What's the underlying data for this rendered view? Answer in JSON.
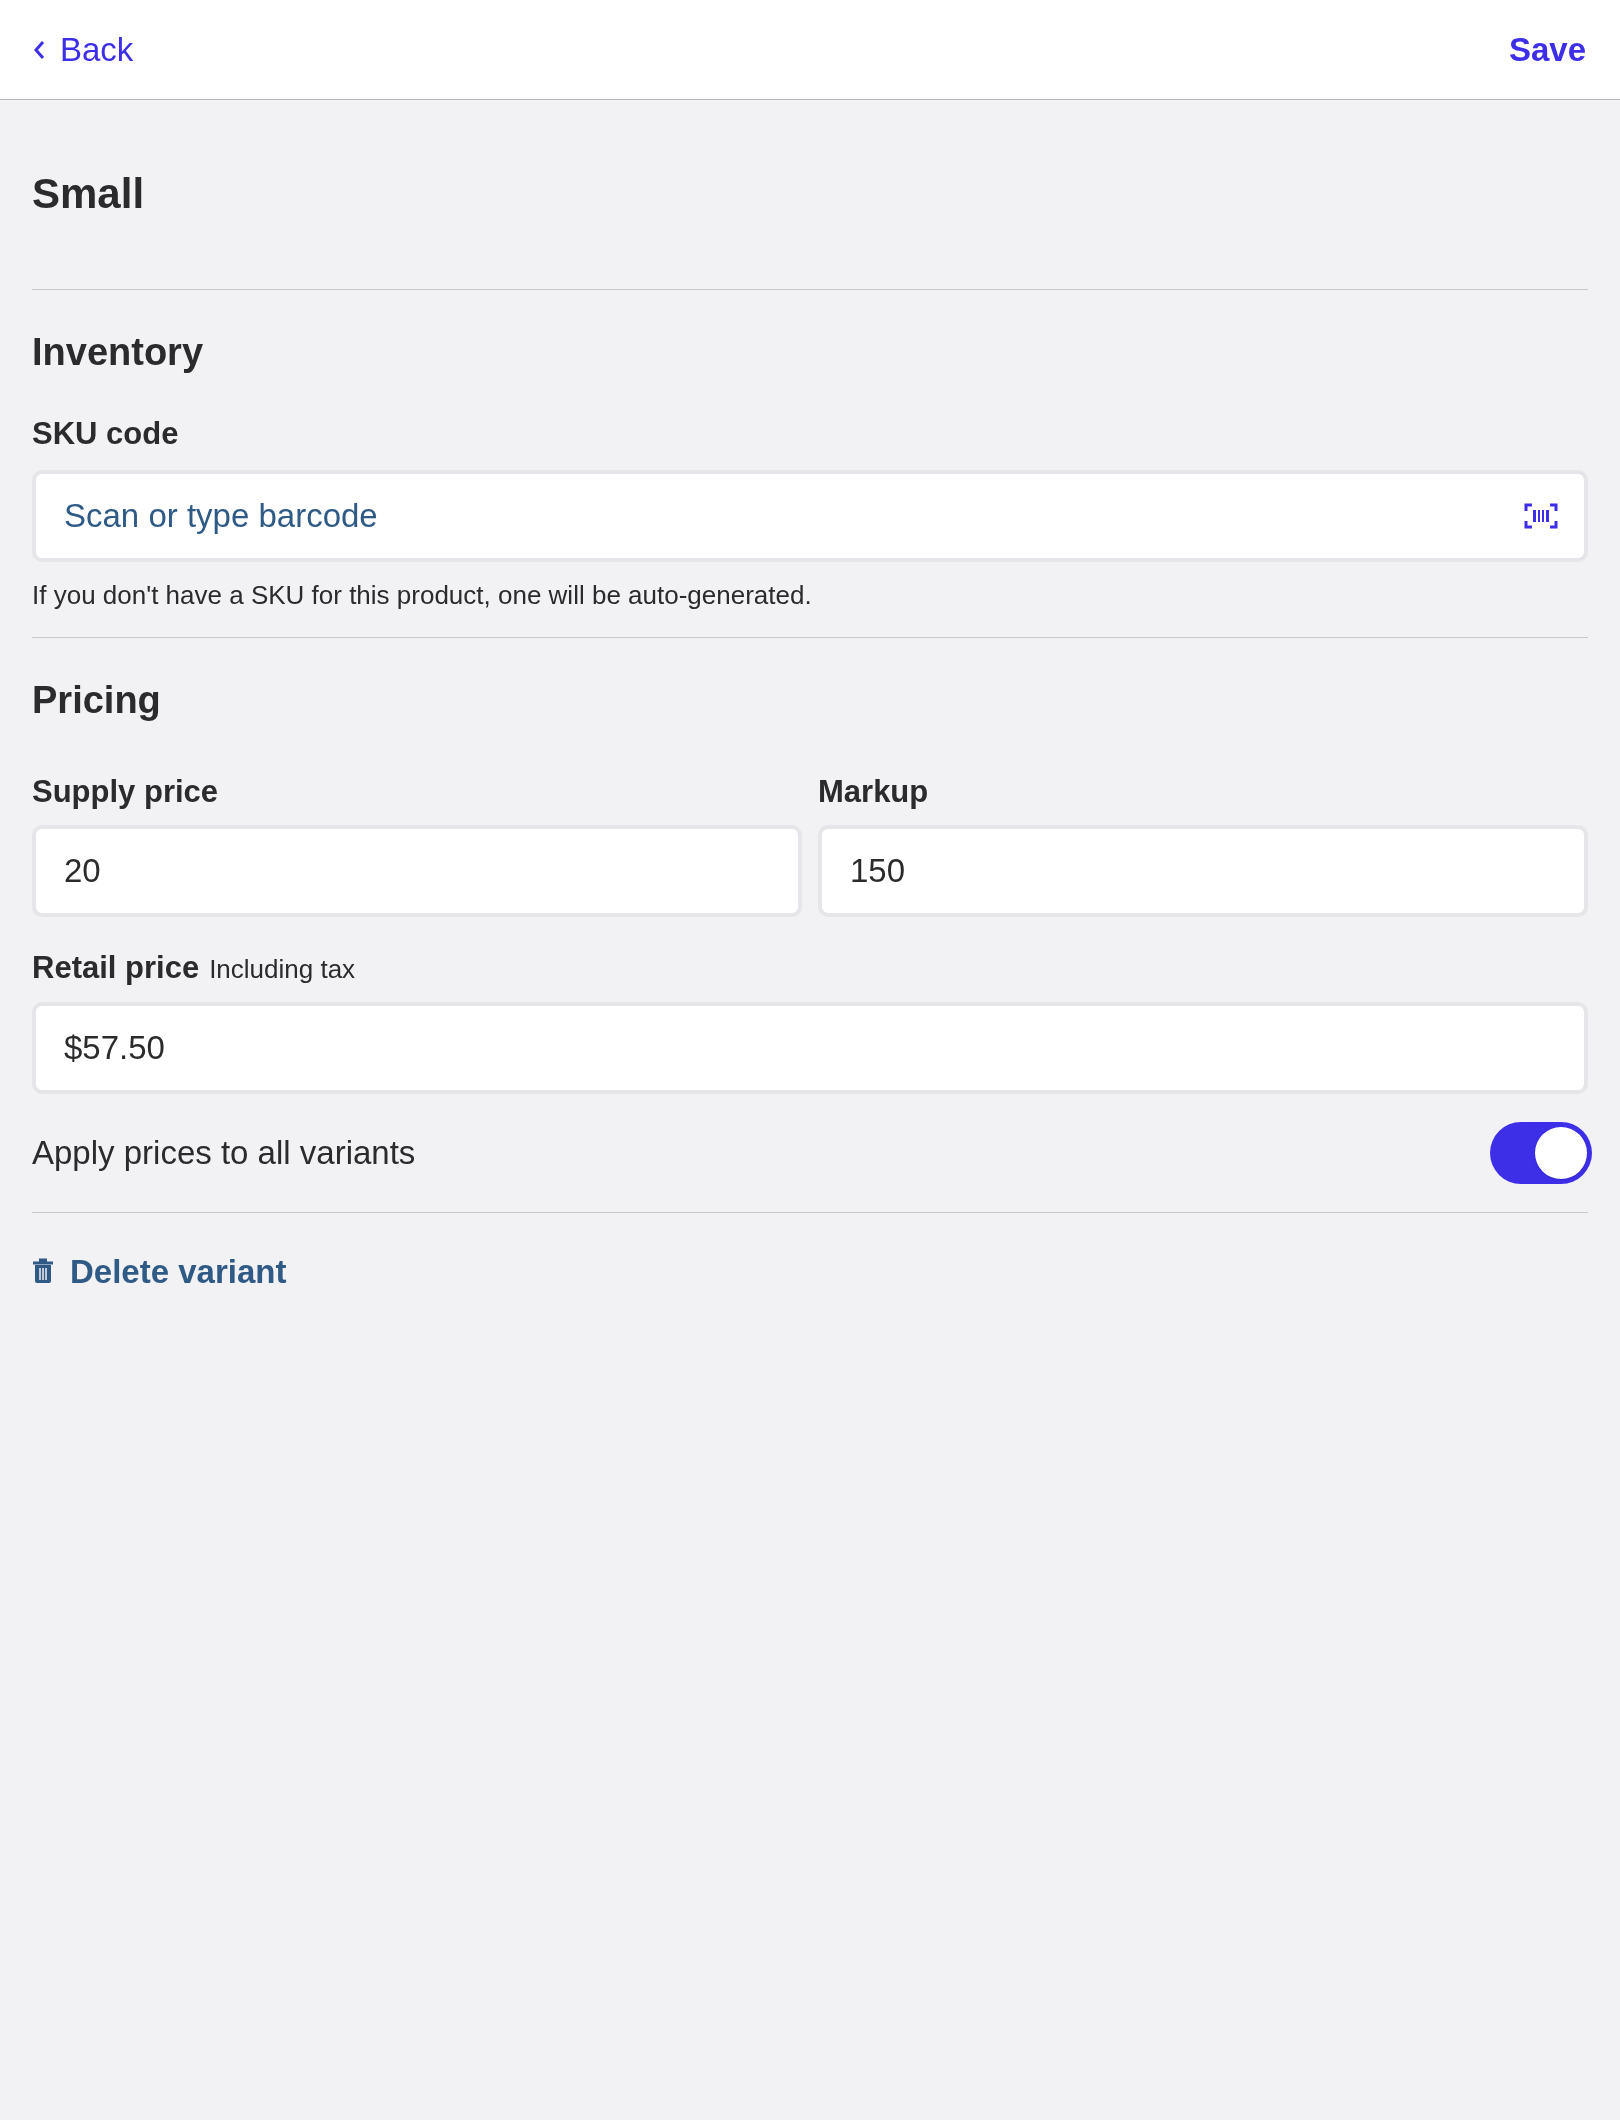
{
  "header": {
    "back": "Back",
    "save": "Save"
  },
  "title": "Small",
  "inventory": {
    "heading": "Inventory",
    "sku_label": "SKU code",
    "sku_placeholder": "Scan or type barcode",
    "hint": "If you don't have a SKU for this product, one will be auto-generated."
  },
  "pricing": {
    "heading": "Pricing",
    "fields": [
      {
        "label": "Supply price",
        "value": "20"
      },
      {
        "label": "Markup",
        "value": "150"
      }
    ],
    "retail": {
      "label": "Retail price",
      "note": "Including tax",
      "value": "$57.50"
    },
    "apply_all": {
      "label": "Apply prices to all variants",
      "on": true
    }
  },
  "delete": "Delete variant"
}
